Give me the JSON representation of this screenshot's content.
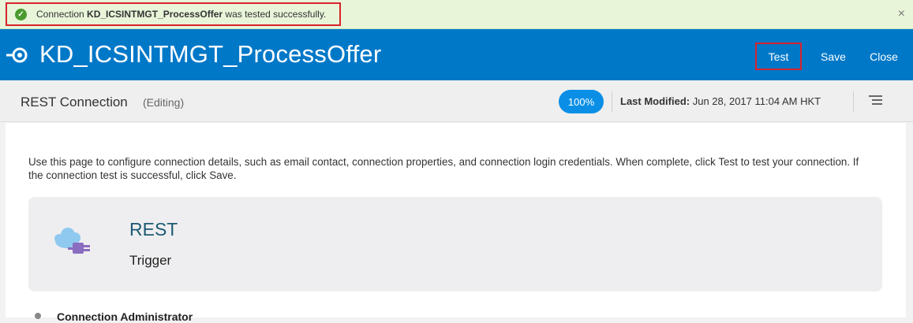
{
  "banner": {
    "prefix": "Connection ",
    "connection_name": "KD_ICSINTMGT_ProcessOffer",
    "suffix": " was tested successfully.",
    "close_glyph": "×"
  },
  "header": {
    "title": "KD_ICSINTMGT_ProcessOffer",
    "test_label": "Test",
    "save_label": "Save",
    "close_label": "Close",
    "background_color": "#0078c8"
  },
  "subheader": {
    "title": "REST Connection",
    "status": "(Editing)",
    "progress": "100%",
    "last_modified_label": "Last Modified:",
    "last_modified_value": " Jun 28, 2017 11:04 AM HKT"
  },
  "main": {
    "description": "Use this page to configure connection details, such as email contact, connection properties, and connection login credentials. When complete, click Test to test your connection. If the connection test is successful, click Save.",
    "card": {
      "title": "REST",
      "role": "Trigger"
    },
    "admin_section_label": "Connection Administrator"
  },
  "icons": {
    "success": "check-circle-icon",
    "connection": "connection-icon",
    "menu": "hamburger-menu-icon",
    "adapter": "rest-cloud-plug-icon"
  }
}
